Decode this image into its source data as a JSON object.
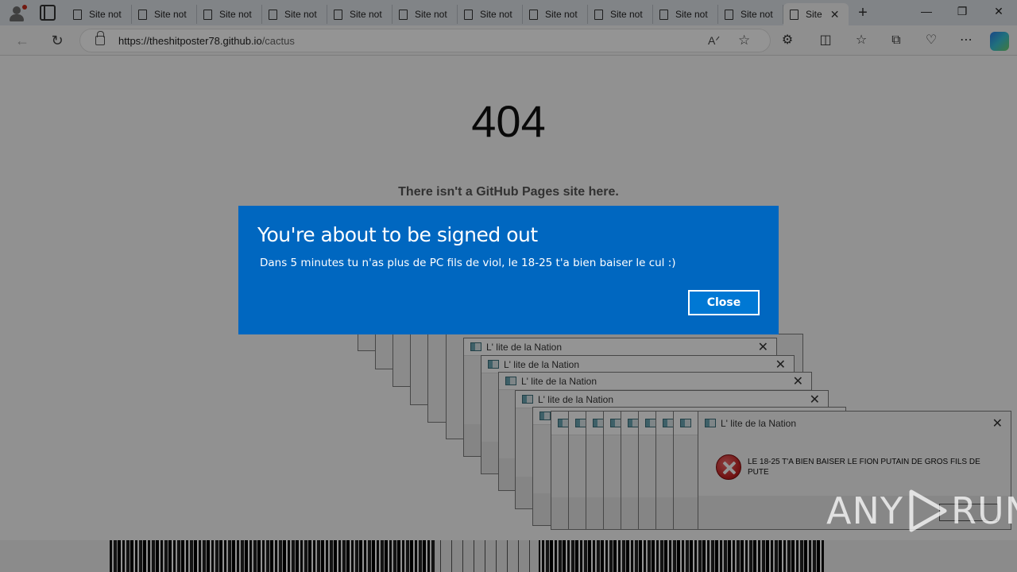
{
  "browser": {
    "tabs": [
      {
        "label": "Site not"
      },
      {
        "label": "Site not"
      },
      {
        "label": "Site not"
      },
      {
        "label": "Site not"
      },
      {
        "label": "Site not"
      },
      {
        "label": "Site not"
      },
      {
        "label": "Site not"
      },
      {
        "label": "Site not"
      },
      {
        "label": "Site not"
      },
      {
        "label": "Site not"
      },
      {
        "label": "Site not"
      }
    ],
    "active_tab": {
      "label": "Site",
      "close": "✕"
    },
    "new_tab": "+",
    "window_controls": {
      "minimize": "—",
      "restore": "❐",
      "close": "✕"
    },
    "url_host": "https://theshitposter78.github.io",
    "url_path": "/cactus"
  },
  "page": {
    "code": "404",
    "message": "There isn't a GitHub Pages site here."
  },
  "error_windows": {
    "title": "L' lite de la Nation",
    "close": "✕",
    "message": "LE 18-25 T'A BIEN BAISER LE FION PUTAIN DE GROS FILS DE PUTE"
  },
  "dialog": {
    "title": "You're about to be signed out",
    "body": "Dans 5 minutes tu n'as plus de PC fils de viol, le 18-25 t'a bien baiser le cul :)",
    "close_label": "Close"
  },
  "watermark": {
    "left": "ANY",
    "right": "RUN"
  },
  "colors": {
    "dialog_bg": "#0067c0",
    "error_red": "#c21f1f"
  }
}
